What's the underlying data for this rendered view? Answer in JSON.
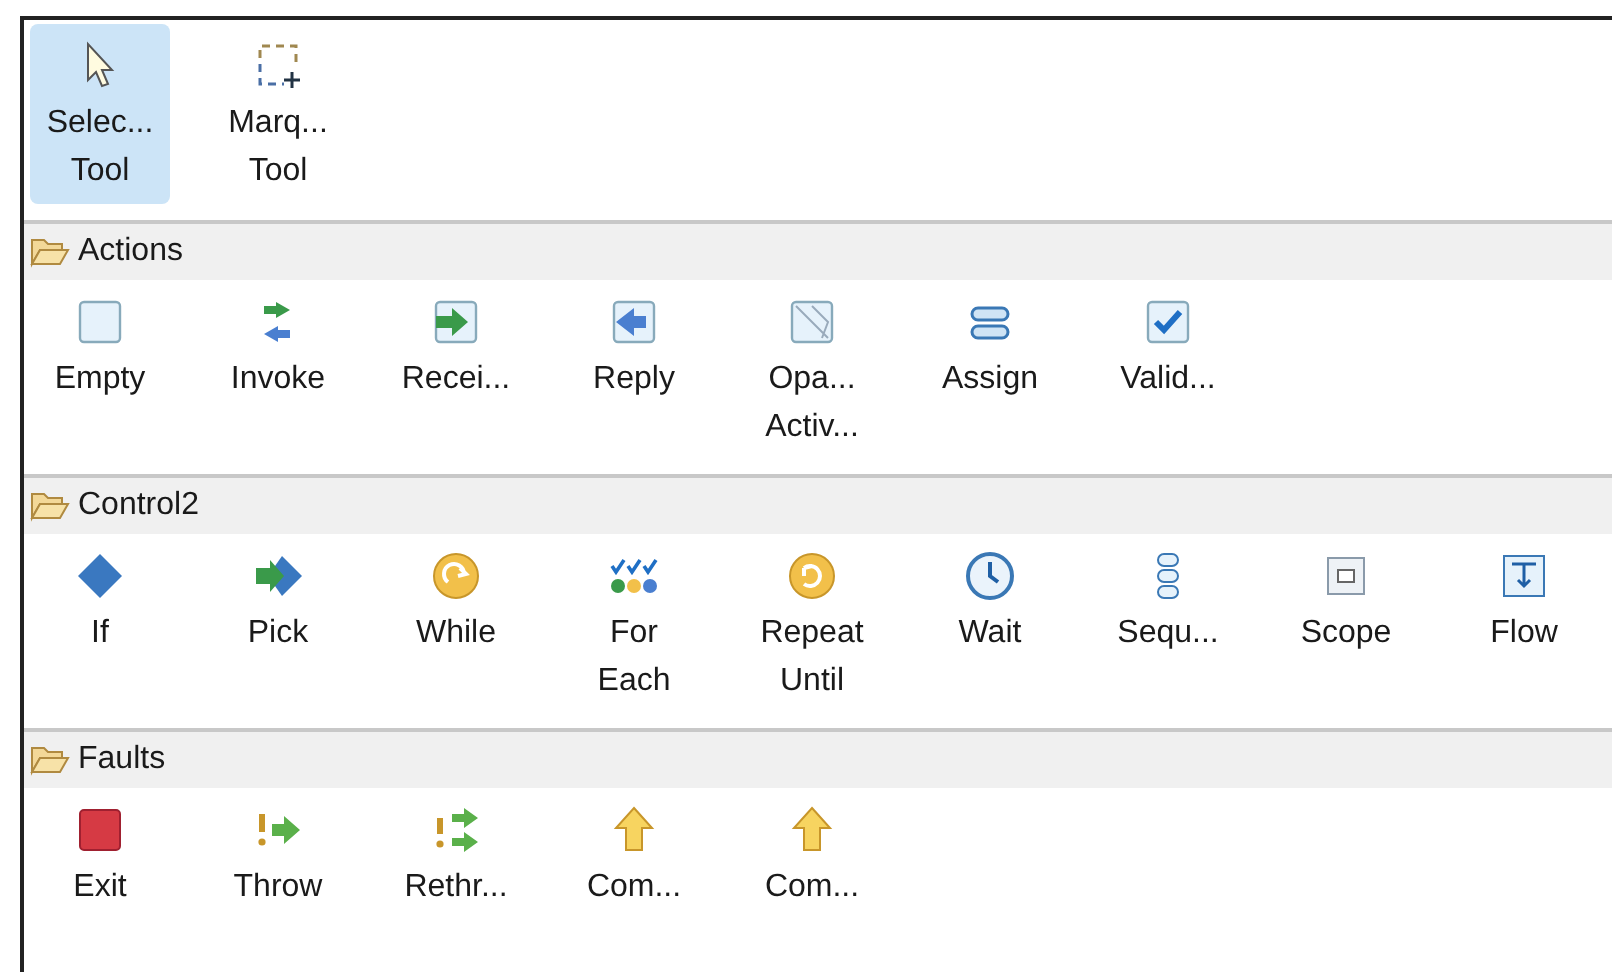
{
  "tools": [
    {
      "label": "Selec...\nTool",
      "selected": true
    },
    {
      "label": "Marq...\nTool",
      "selected": false
    }
  ],
  "drawers": [
    {
      "title": "Actions",
      "items": [
        {
          "label": "Empty"
        },
        {
          "label": "Invoke"
        },
        {
          "label": "Recei..."
        },
        {
          "label": "Reply"
        },
        {
          "label": "Opa...\nActiv..."
        },
        {
          "label": "Assign"
        },
        {
          "label": "Valid..."
        }
      ]
    },
    {
      "title": "Control2",
      "items": [
        {
          "label": "If"
        },
        {
          "label": "Pick"
        },
        {
          "label": "While"
        },
        {
          "label": "For\nEach"
        },
        {
          "label": "Repeat\nUntil"
        },
        {
          "label": "Wait"
        },
        {
          "label": "Sequ..."
        },
        {
          "label": "Scope"
        },
        {
          "label": "Flow"
        }
      ]
    },
    {
      "title": "Faults",
      "items": [
        {
          "label": "Exit"
        },
        {
          "label": "Throw"
        },
        {
          "label": "Rethr..."
        },
        {
          "label": "Com..."
        },
        {
          "label": "Com..."
        }
      ]
    }
  ]
}
